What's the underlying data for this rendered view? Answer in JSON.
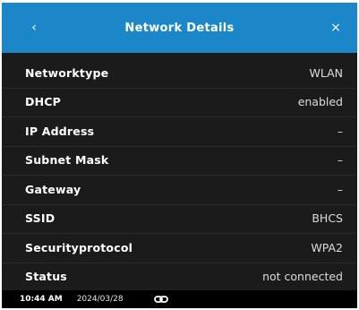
{
  "header": {
    "title": "Network Details",
    "back_glyph": "‹",
    "close_glyph": "×",
    "background_color": "#1b87c8"
  },
  "details": [
    {
      "label": "Networktype",
      "value": "WLAN"
    },
    {
      "label": "DHCP",
      "value": "enabled"
    },
    {
      "label": "IP Address",
      "value": "–"
    },
    {
      "label": "Subnet Mask",
      "value": "–"
    },
    {
      "label": "Gateway",
      "value": "–"
    },
    {
      "label": "SSID",
      "value": "BHCS"
    },
    {
      "label": "Securityprotocol",
      "value": "WPA2"
    },
    {
      "label": "Status",
      "value": "not connected"
    }
  ],
  "statusbar": {
    "time": "10:44 AM",
    "date": "2024/03/28",
    "icon": "link-icon"
  }
}
